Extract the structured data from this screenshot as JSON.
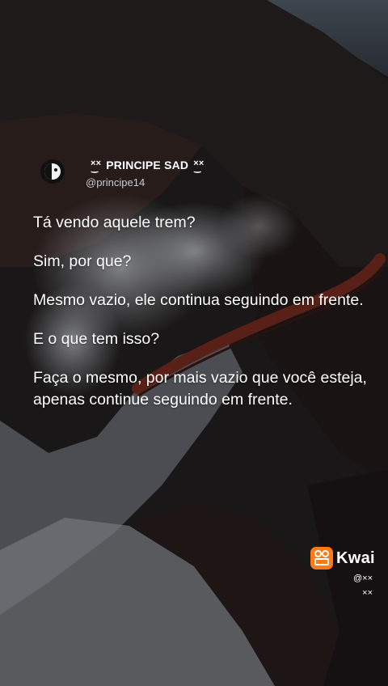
{
  "post": {
    "display_name": "PRINCIPE SAD",
    "name_decoration": "××",
    "handle": "@principe14"
  },
  "dialogue": [
    "Tá vendo aquele trem?",
    "Sim, por que?",
    "Mesmo vazio, ele continua seguindo em frente.",
    "E o que tem isso?",
    "Faça o mesmo, por mais vazio que você esteja, apenas continue seguindo em frente."
  ],
  "watermark": {
    "brand": "Kwai",
    "user_line_1": "@××",
    "user_line_2": "××"
  },
  "colors": {
    "brand_orange": "#ff7a16",
    "text": "#ffffff",
    "train": "#8a2e1f"
  }
}
